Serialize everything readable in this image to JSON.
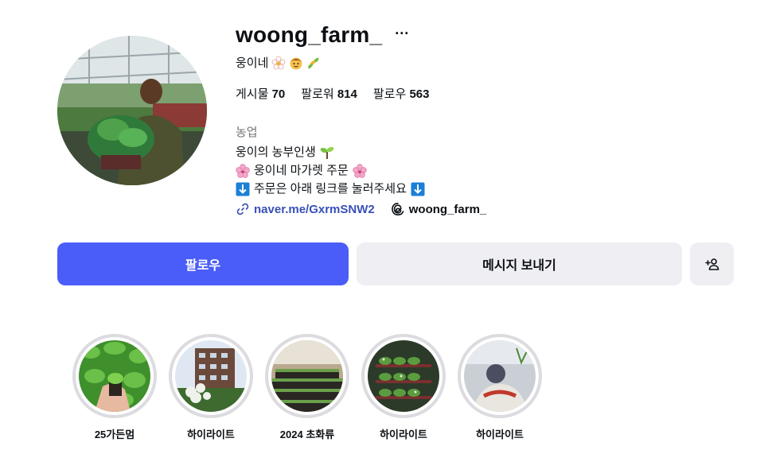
{
  "profile": {
    "username": "woong_farm_",
    "more": "···",
    "full_name": "웅이네",
    "full_name_emojis": [
      "flower-icon",
      "boy-face-icon",
      "herb-icon"
    ],
    "stats": {
      "posts_label": "게시물",
      "posts_value": "70",
      "followers_label": "팔로워",
      "followers_value": "814",
      "following_label": "팔로우",
      "following_value": "563"
    },
    "category": "농업",
    "bio": {
      "line1": "웅이의 농부인생",
      "line2": "웅이네 마가렛 주문",
      "line3": "주문은 아래 링크를 눌러주세요"
    },
    "link": "naver.me/GxrmSNW2",
    "threads": "woong_farm_"
  },
  "actions": {
    "follow": "팔로우",
    "message": "메시지 보내기"
  },
  "highlights": [
    {
      "label": "25가든멈"
    },
    {
      "label": "하이라이트"
    },
    {
      "label": "2024 초화류"
    },
    {
      "label": "하이라이트"
    },
    {
      "label": "하이라이트"
    }
  ],
  "colors": {
    "primary_button": "#4a5df9",
    "secondary_button": "#efeff3",
    "link": "#3950b8",
    "muted_text": "#737373"
  }
}
